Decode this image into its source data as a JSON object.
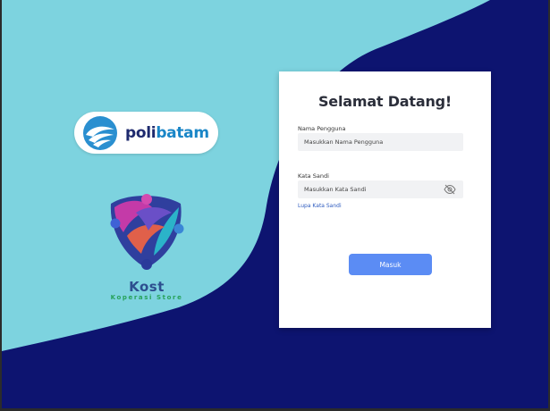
{
  "colors": {
    "background_dark": "#0d1470",
    "background_light": "#7dd3df",
    "button": "#5b8cf4",
    "card": "#ffffff"
  },
  "poli_logo": {
    "prefix": "poli",
    "suffix": "batam"
  },
  "kost_logo": {
    "lettering": "Kost",
    "tagline": "Koperasi Store"
  },
  "login": {
    "title": "Selamat Datang!",
    "username": {
      "label": "Nama Pengguna",
      "placeholder": "Masukkan Nama Pengguna",
      "value": ""
    },
    "password": {
      "label": "Kata Sandi",
      "placeholder": "Masukkan Kata Sandi",
      "value": "",
      "toggle_icon": "eye-off-icon"
    },
    "forgot_link": "Lupa Kata Sandi",
    "submit_label": "Masuk"
  }
}
